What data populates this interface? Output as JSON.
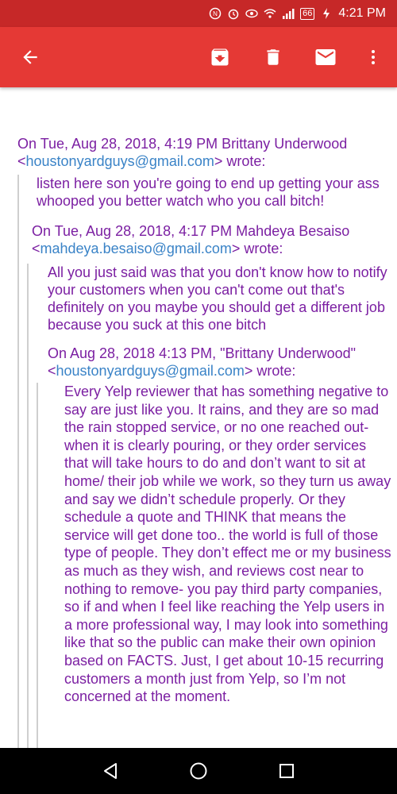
{
  "status_bar": {
    "battery": "66",
    "time": "4:21 PM"
  },
  "colors": {
    "status_bar": "#c62828",
    "app_bar": "#e53935",
    "quote_text": "#7b1fa2",
    "email_link": "#3a83c7"
  },
  "toolbar": {
    "icons": [
      "back-arrow-icon",
      "archive-icon",
      "delete-icon",
      "mail-icon",
      "more-vert-icon"
    ]
  },
  "thread": {
    "quote1": {
      "attribution_prefix": "On Tue, Aug 28, 2018, 4:19 PM Brittany Underwood <",
      "email": "houstonyardguys@gmail.com",
      "attribution_suffix": "> wrote:",
      "body": "listen here son you're going to end up getting your ass whooped you better watch who you call bitch!"
    },
    "quote2": {
      "attribution_prefix": "On Tue, Aug 28, 2018, 4:17 PM Mahdeya Besaiso <",
      "email": "mahdeya.besaiso@gmail.com",
      "attribution_suffix": "> wrote:",
      "body": "All you just said was that you don't know how to notify your customers when you can't come out that's definitely on you maybe you should get a different job because you suck at this one bitch"
    },
    "quote3": {
      "attribution_prefix": "On Aug 28, 2018 4:13 PM, \"Brittany Underwood\" <",
      "email": "houstonyardguys@gmail.com",
      "attribution_suffix": "> wrote:",
      "body": "Every Yelp reviewer that has something negative to say are just like you. It rains, and they are so mad the rain stopped service, or no one reached out- when it is clearly pouring, or they order services that will take hours to do and don’t want to sit at home/ their job while we work, so they turn us away and say we didn’t schedule properly. Or they schedule a quote and THINK that means the service will get done too.. the world is full of those type of people. They don’t effect me or my business as much as they wish, and reviews cost near to nothing to remove- you pay third party companies, so if and when I feel like reaching the Yelp users in a more professional way, I may look into something like that so the public can make their own opinion based on FACTS. Just, I get about 10-15 recurring customers a month just from Yelp, so I’m not concerned at the moment."
    }
  },
  "navigation": {
    "icons": [
      "back-triangle-icon",
      "home-circle-icon",
      "recents-square-icon"
    ]
  }
}
